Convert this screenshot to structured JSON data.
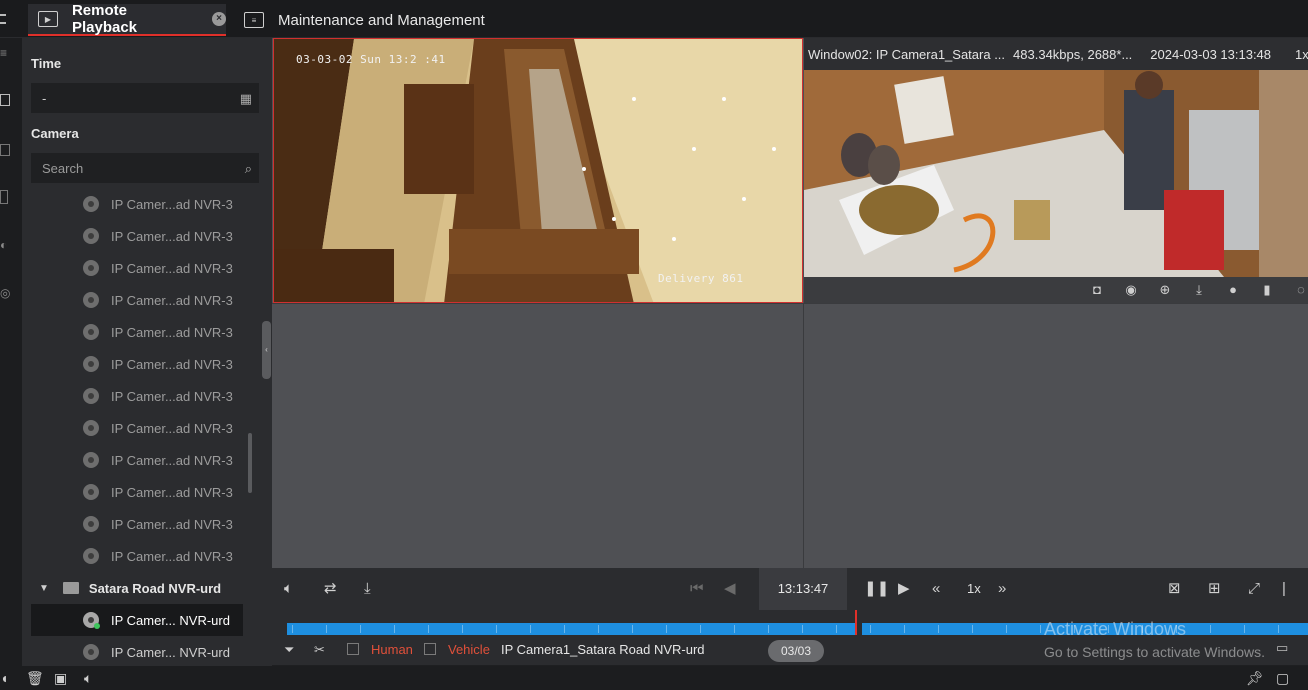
{
  "tabs": [
    {
      "label": "Remote Playback",
      "active": true
    },
    {
      "label": "Maintenance and Management",
      "active": false
    }
  ],
  "sidebar": {
    "time_label": "Time",
    "time_value": "-",
    "camera_label": "Camera",
    "search_placeholder": "Search",
    "cameras": [
      "IP Camer...ad NVR-3",
      "IP Camer...ad NVR-3",
      "IP Camer...ad NVR-3",
      "IP Camer...ad NVR-3",
      "IP Camer...ad NVR-3",
      "IP Camer...ad NVR-3",
      "IP Camer...ad NVR-3",
      "IP Camer...ad NVR-3",
      "IP Camer...ad NVR-3",
      "IP Camer...ad NVR-3",
      "IP Camer...ad NVR-3",
      "IP Camer...ad NVR-3"
    ],
    "group_name": "Satara Road NVR-urd",
    "group_cameras": [
      "IP Camer... NVR-urd",
      "IP Camer... NVR-urd"
    ]
  },
  "window1": {
    "osd_time": "03-03-02  Sun 13:2 :41",
    "osd_label": "Delivery 861"
  },
  "window2": {
    "title_name": "Window02:  IP Camera1_Satara ...",
    "bitrate": "483.34kbps, 2688*...",
    "datetime": "2024-03-03 13:13:48",
    "speed": "1x"
  },
  "controls": {
    "current_time": "13:13:47",
    "speed": "1x"
  },
  "timeline": {
    "playhead_time": "13:13:47"
  },
  "filter": {
    "human_label": "Human",
    "vehicle_label": "Vehicle",
    "camera_name": "IP Camera1_Satara Road NVR-urd",
    "page": "03/03"
  },
  "watermark": {
    "line1": "Activate Windows",
    "line2": "Go to Settings to activate Windows."
  },
  "colors": {
    "accent_red": "#e0302a",
    "timeline_blue": "#1e8fe0",
    "online_green": "#3ec45c"
  }
}
